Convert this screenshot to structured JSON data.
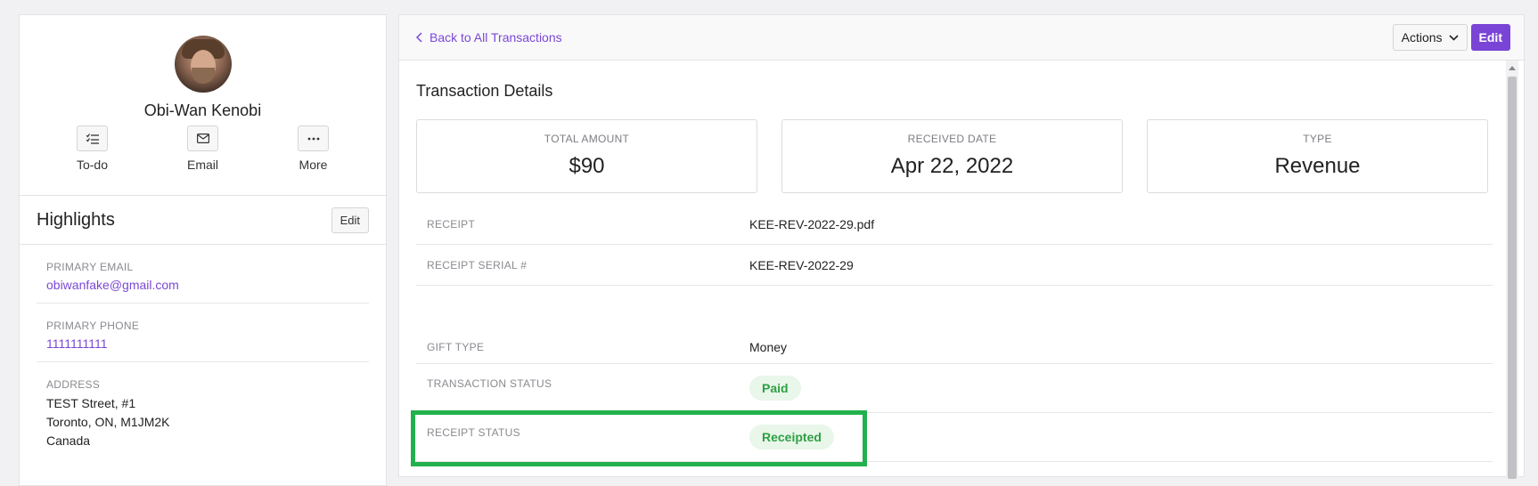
{
  "profile": {
    "name": "Obi-Wan Kenobi",
    "avatar_icon": "user-avatar-photo",
    "actions": [
      {
        "label": "To-do",
        "icon": "checklist-icon"
      },
      {
        "label": "Email",
        "icon": "mail-icon"
      },
      {
        "label": "More",
        "icon": "ellipsis-icon"
      }
    ]
  },
  "highlights": {
    "title": "Highlights",
    "edit_label": "Edit",
    "primary_email_label": "PRIMARY EMAIL",
    "primary_email": "obiwanfake@gmail.com",
    "primary_phone_label": "PRIMARY PHONE",
    "primary_phone": "1111111111",
    "address_label": "ADDRESS",
    "address_lines": [
      "TEST Street, #1",
      "Toronto, ON, M1JM2K",
      "Canada"
    ]
  },
  "topbar": {
    "back_label": "Back to All Transactions",
    "actions_label": "Actions",
    "edit_label": "Edit"
  },
  "transaction": {
    "title": "Transaction Details",
    "cards": [
      {
        "label": "TOTAL AMOUNT",
        "value": "$90"
      },
      {
        "label": "RECEIVED DATE",
        "value": "Apr 22, 2022"
      },
      {
        "label": "TYPE",
        "value": "Revenue"
      }
    ],
    "receipt_label": "RECEIPT",
    "receipt_file": "KEE-REV-2022-29.pdf",
    "receipt_serial_label": "RECEIPT SERIAL #",
    "receipt_serial": "KEE-REV-2022-29",
    "gift_type_label": "GIFT TYPE",
    "gift_type": "Money",
    "transaction_status_label": "TRANSACTION STATUS",
    "transaction_status": "Paid",
    "receipt_status_label": "RECEIPT STATUS",
    "receipt_status": "Receipted"
  },
  "colors": {
    "accent": "#7a44d6",
    "success": "#2ea043",
    "success_bg": "#e9f6ea",
    "highlight_box": "#22b14c"
  }
}
